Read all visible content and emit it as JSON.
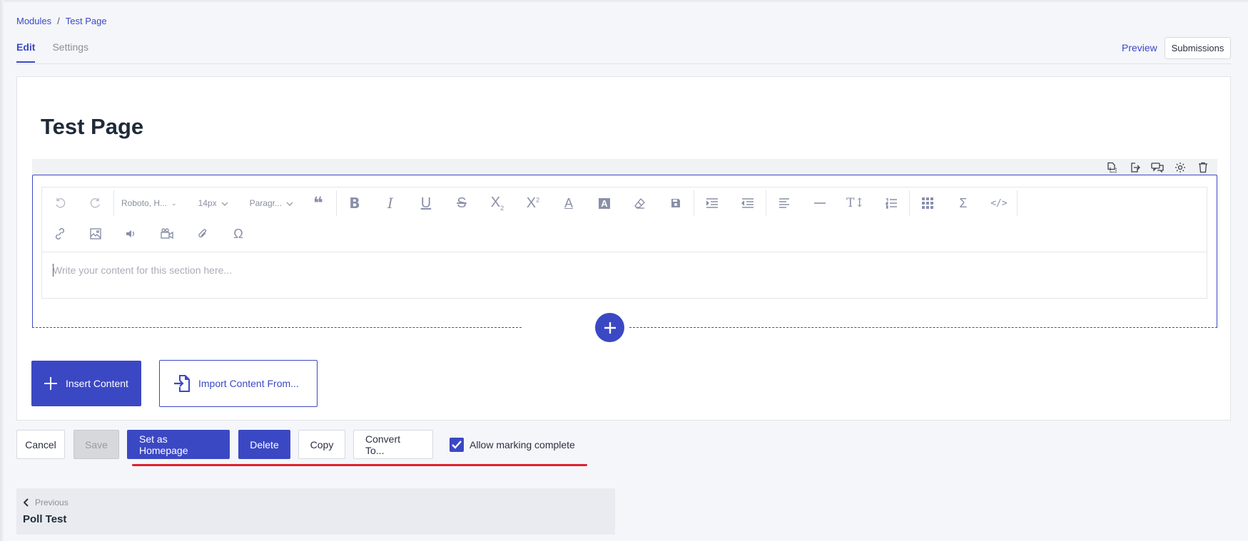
{
  "breadcrumb": {
    "root": "Modules",
    "separator": "/",
    "current": "Test Page"
  },
  "tabs": [
    {
      "label": "Edit",
      "active": true
    },
    {
      "label": "Settings",
      "active": false
    }
  ],
  "header": {
    "preview": "Preview",
    "submissions": "Submissions"
  },
  "page": {
    "title": "Test Page"
  },
  "section_icons": [
    "copy-section-icon",
    "export-icon",
    "comments-icon",
    "gear-icon",
    "trash-icon"
  ],
  "toolbar": {
    "font_family": "Roboto, H...",
    "font_size": "14px",
    "block_format": "Paragr...",
    "row1_icons": [
      "undo-icon",
      "redo-icon",
      "quote-icon",
      "bold-icon",
      "italic-icon",
      "underline-icon",
      "strikethrough-icon",
      "subscript-icon",
      "superscript-icon",
      "text-color-icon",
      "highlight-icon",
      "eraser-icon",
      "save-icon",
      "indent-icon",
      "outdent-icon",
      "align-left-icon",
      "horizontal-rule-icon",
      "line-height-icon",
      "numbered-list-icon",
      "table-icon",
      "sigma-icon",
      "code-icon"
    ],
    "row2_icons": [
      "link-icon",
      "image-icon",
      "audio-icon",
      "video-icon",
      "attachment-icon",
      "omega-icon"
    ]
  },
  "editor": {
    "placeholder": "Write your content for this section here..."
  },
  "content_buttons": {
    "insert": "Insert Content",
    "import": "Import Content From..."
  },
  "actions": {
    "cancel": "Cancel",
    "save": "Save",
    "set_homepage": "Set as Homepage",
    "delete": "Delete",
    "copy": "Copy",
    "convert": "Convert To...",
    "allow_marking_complete": {
      "label": "Allow marking complete",
      "checked": true
    }
  },
  "navigation": {
    "previous_label": "Previous",
    "previous_title": "Poll Test"
  },
  "colors": {
    "accent": "#3b48c4",
    "underline": "#e0202f",
    "background": "#f5f6fa"
  }
}
